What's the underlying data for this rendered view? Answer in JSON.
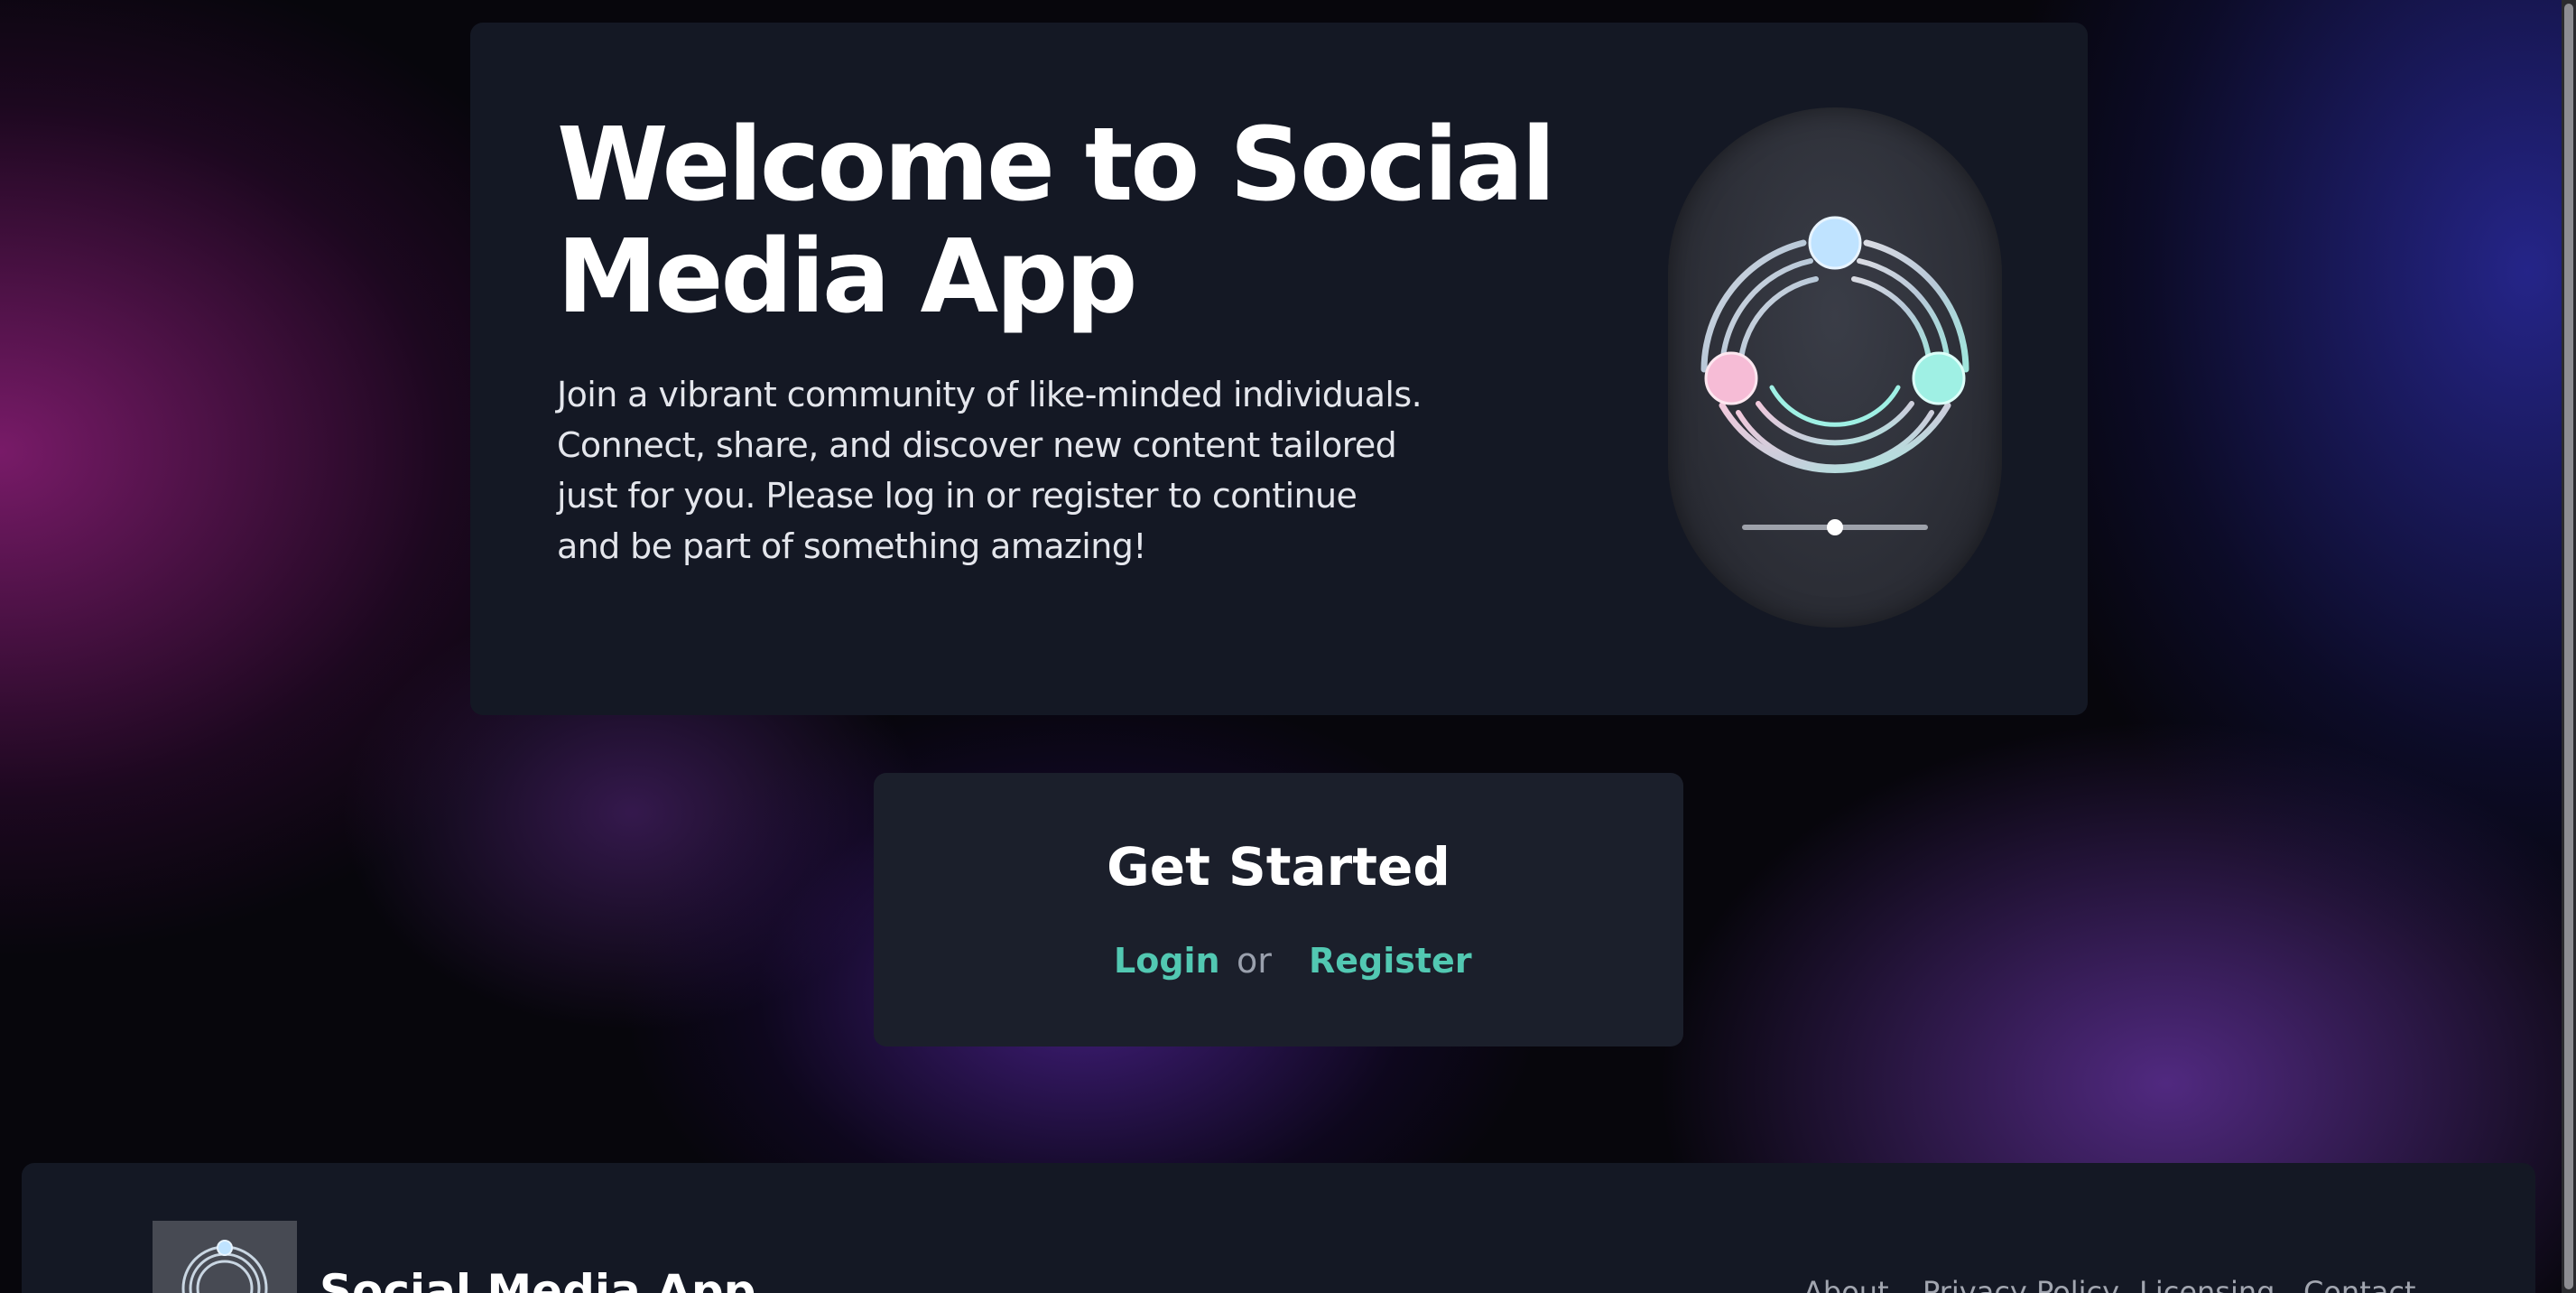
{
  "hero": {
    "title": "Welcome to Social Media App",
    "description": "Join a vibrant community of like-minded individuals. Connect, share, and discover new content tailored just for you. Please log in or register to continue and be part of something amazing!"
  },
  "cta": {
    "title": "Get Started",
    "login_label": "Login",
    "separator": "or",
    "register_label": "Register"
  },
  "footer": {
    "brand": "Social Media App",
    "nav": [
      "About",
      "Privacy Policy",
      "Licensing",
      "Contact"
    ]
  },
  "colors": {
    "link": "#52c8b2",
    "card_background": "#141824",
    "logo_node_top": "#bfe3ff",
    "logo_node_left": "#f6bcd6",
    "logo_node_right": "#9ff0e4"
  },
  "icons": {
    "app_logo": "social-network-rings-logo"
  }
}
